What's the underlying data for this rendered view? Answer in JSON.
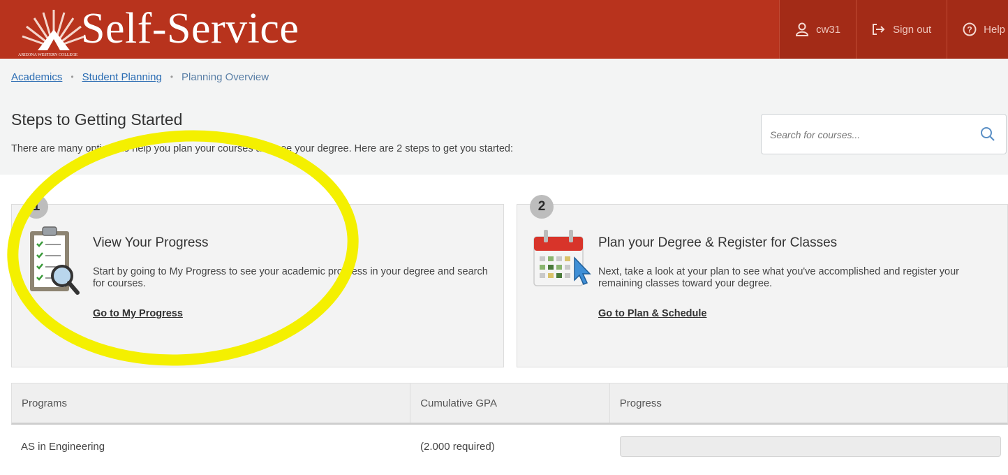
{
  "header": {
    "brand": "Self-Service",
    "logo_caption": "ARIZONA WESTERN COLLEGE",
    "user_label": "cw31",
    "signout_label": "Sign out",
    "help_label": "Help",
    "bg_color": "#b8331d"
  },
  "breadcrumb": {
    "items": [
      "Academics",
      "Student Planning",
      "Planning Overview"
    ]
  },
  "steps": {
    "title": "Steps to Getting Started",
    "description": "There are many options to help you plan your courses and see your degree. Here are 2 steps to get you started:"
  },
  "search": {
    "placeholder": "Search for courses..."
  },
  "cards": [
    {
      "number": "1",
      "icon": "clipboard-checklist-icon",
      "title": "View Your Progress",
      "text": "Start by going to My Progress to see your academic progress in your degree and search for courses.",
      "link": "Go to My Progress"
    },
    {
      "number": "2",
      "icon": "calendar-icon",
      "title": "Plan your Degree & Register for Classes",
      "text": "Next, take a look at your plan to see what you've accomplished and register your remaining classes toward your degree.",
      "link": "Go to Plan & Schedule"
    }
  ],
  "programs_table": {
    "headers": [
      "Programs",
      "Cumulative GPA",
      "Progress"
    ],
    "rows": [
      {
        "program": "AS in Engineering",
        "gpa": "(2.000 required)",
        "progress": 0
      }
    ]
  },
  "annotation": {
    "color": "#f4f000"
  }
}
